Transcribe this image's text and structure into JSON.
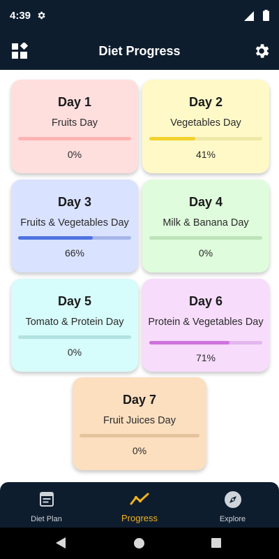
{
  "status_bar": {
    "time": "4:39"
  },
  "app_bar": {
    "title": "Diet Progress"
  },
  "days": [
    {
      "day": "Day 1",
      "name": "Fruits Day",
      "progress": 0,
      "percent_label": "0%",
      "bg": "#ffdede",
      "track": "#ffb3b3",
      "fill": "#f27878"
    },
    {
      "day": "Day 2",
      "name": "Vegetables Day",
      "progress": 41,
      "percent_label": "41%",
      "bg": "#fff9c8",
      "track": "#efe9a8",
      "fill": "#f2d22c"
    },
    {
      "day": "Day 3",
      "name": "Fruits & Vegetables Day",
      "progress": 66,
      "percent_label": "66%",
      "bg": "#d9e2ff",
      "track": "#a6b5e8",
      "fill": "#4f74e0"
    },
    {
      "day": "Day 4",
      "name": "Milk & Banana Day",
      "progress": 0,
      "percent_label": "0%",
      "bg": "#dffcdc",
      "track": "#bde3b8",
      "fill": "#5fc45a"
    },
    {
      "day": "Day 5",
      "name": "Tomato & Protein Day",
      "progress": 0,
      "percent_label": "0%",
      "bg": "#d6fcfb",
      "track": "#b2e2e0",
      "fill": "#3ec6c2"
    },
    {
      "day": "Day 6",
      "name": "Protein & Vegetables Day",
      "progress": 71,
      "percent_label": "71%",
      "bg": "#f7dcfc",
      "track": "#e3b6ee",
      "fill": "#cf72dd"
    },
    {
      "day": "Day 7",
      "name": "Fruit Juices Day",
      "progress": 0,
      "percent_label": "0%",
      "bg": "#fbdfbf",
      "track": "#e4c39d",
      "fill": "#d8914a"
    }
  ],
  "bottom_nav": {
    "items": [
      {
        "label": "Diet Plan",
        "icon": "calendar-list-icon"
      },
      {
        "label": "Progress",
        "icon": "trend-line-icon",
        "active": true
      },
      {
        "label": "Explore",
        "icon": "compass-icon"
      }
    ],
    "active_color": "#f3b21e"
  },
  "colors": {
    "bar_bg": "#0e1d2e",
    "page_bg": "#ffffff"
  }
}
